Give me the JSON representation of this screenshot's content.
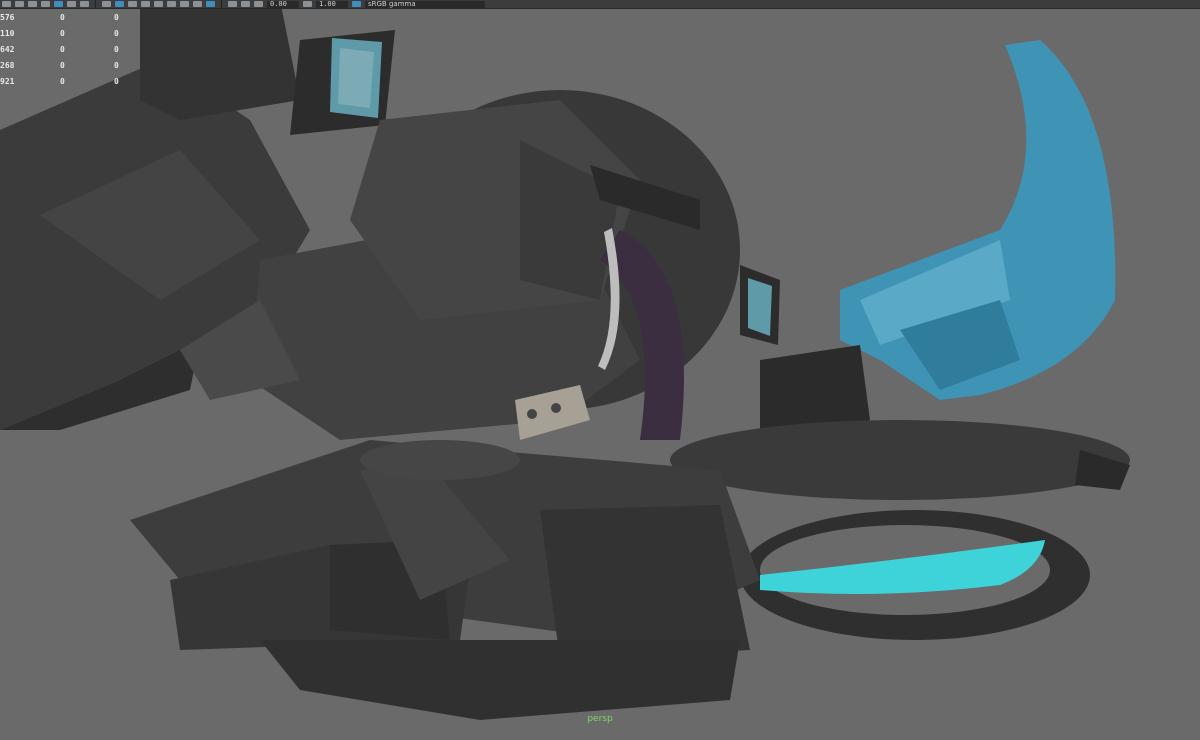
{
  "toolbar": {
    "field_a": "0.00",
    "field_b": "1.00",
    "color_space": "sRGB gamma",
    "icons": [
      "select-icon",
      "move-icon",
      "grid-icon",
      "camera-icon",
      "lights-icon",
      "shading-icon",
      "texture-icon",
      "wireframe-icon",
      "xray-icon",
      "isolate-icon",
      "shadow-icon",
      "ao-icon",
      "aa-icon",
      "dof-icon",
      "film-gate-icon",
      "resolution-gate-icon",
      "safe-action-icon",
      "field-chart-icon",
      "exposure-icon",
      "gamma-icon",
      "colorspace-icon"
    ]
  },
  "hud": {
    "rows": [
      [
        "576",
        "0",
        "0"
      ],
      [
        "110",
        "0",
        "0"
      ],
      [
        "642",
        "0",
        "0"
      ],
      [
        "268",
        "0",
        "0"
      ],
      [
        "921",
        "0",
        "0"
      ]
    ]
  },
  "viewport": {
    "camera": "persp",
    "background": "#6a6a6a",
    "accent_blue": "#3f93b4",
    "accent_cyan": "#3dd3d8"
  }
}
